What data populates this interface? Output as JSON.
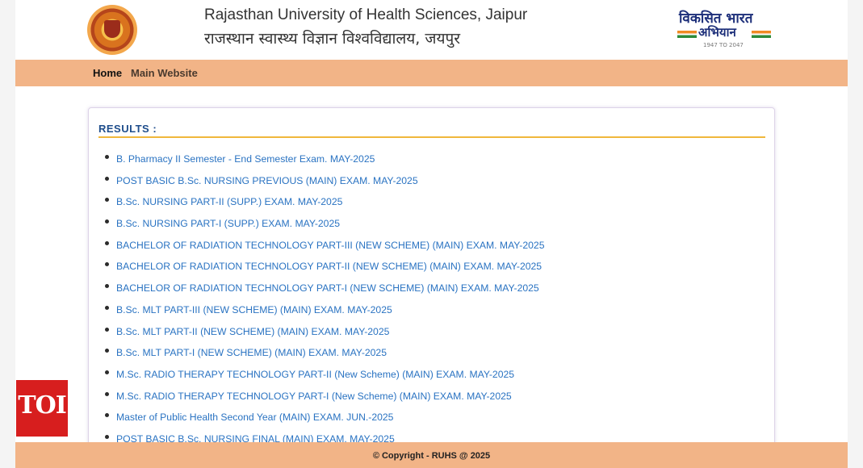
{
  "header": {
    "title_en": "Rajasthan University of Health Sciences, Jaipur",
    "title_hi": "राजस्थान स्वास्थ्य विज्ञान विश्वविद्यालय, जयपुर",
    "badge_line1": "विकसित भारत",
    "badge_line2": "अभियान",
    "badge_years": "1947 TO 2047"
  },
  "nav": {
    "items": [
      {
        "label": "Home"
      },
      {
        "label": "Main Website"
      }
    ]
  },
  "results": {
    "heading": "RESULTS :",
    "items": [
      "B. Pharmacy II Semester - End Semester Exam. MAY-2025",
      "POST BASIC B.Sc. NURSING PREVIOUS (MAIN) EXAM. MAY-2025",
      "B.Sc. NURSING PART-II (SUPP.) EXAM. MAY-2025",
      "B.Sc. NURSING PART-I (SUPP.) EXAM. MAY-2025",
      "BACHELOR OF RADIATION TECHNOLOGY PART-III (NEW SCHEME) (MAIN) EXAM. MAY-2025",
      "BACHELOR OF RADIATION TECHNOLOGY PART-II (NEW SCHEME) (MAIN) EXAM. MAY-2025",
      "BACHELOR OF RADIATION TECHNOLOGY PART-I (NEW SCHEME) (MAIN) EXAM. MAY-2025",
      "B.Sc. MLT PART-III (NEW SCHEME) (MAIN) EXAM. MAY-2025",
      "B.Sc. MLT PART-II (NEW SCHEME) (MAIN) EXAM. MAY-2025",
      "B.Sc. MLT PART-I (NEW SCHEME) (MAIN) EXAM. MAY-2025",
      "M.Sc. RADIO THERAPY TECHNOLOGY PART-II (New Scheme) (MAIN) EXAM. MAY-2025",
      "M.Sc. RADIO THERAPY TECHNOLOGY PART-I (New Scheme) (MAIN) EXAM. MAY-2025",
      "Master of Public Health Second Year (MAIN) EXAM. JUN.-2025",
      "POST BASIC B.Sc. NURSING FINAL (MAIN) EXAM. MAY-2025"
    ]
  },
  "footer": {
    "copyright": "© Copyright - RUHS @ 2025"
  },
  "watermark": {
    "text": "TOI"
  },
  "colors": {
    "nav_bg": "#f2b487",
    "link": "#2a73c2",
    "heading": "#1f4e8c",
    "rule": "#f0b73c",
    "watermark_bg": "#d71e1e"
  }
}
